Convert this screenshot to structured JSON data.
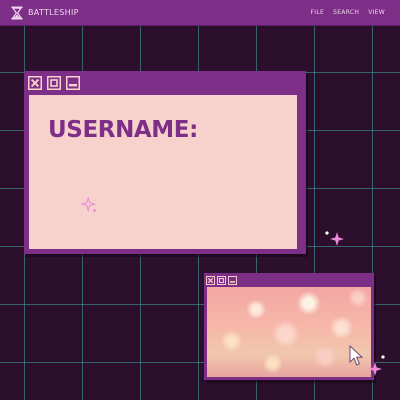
{
  "app": {
    "title": "BATTLESHIP",
    "logo_icon": "hourglass-icon"
  },
  "menu": {
    "items": [
      "FILE",
      "SEARCH",
      "VIEW"
    ]
  },
  "main_window": {
    "controls": [
      "close-icon",
      "maximize-icon",
      "minimize-icon"
    ],
    "label": "USERNAME:"
  },
  "image_window": {
    "controls": [
      "close-icon",
      "maximize-icon",
      "minimize-icon"
    ],
    "image_icon": "glitter-bokeh-image",
    "cursor_icon": "cursor-icon"
  },
  "colors": {
    "background": "#2b0f2c",
    "grid": "#40aaa0",
    "accent": "#7d2e86",
    "panel": "#f7d2cc",
    "text_light": "#f1d6ef",
    "sparkle": "#f08ad8"
  }
}
